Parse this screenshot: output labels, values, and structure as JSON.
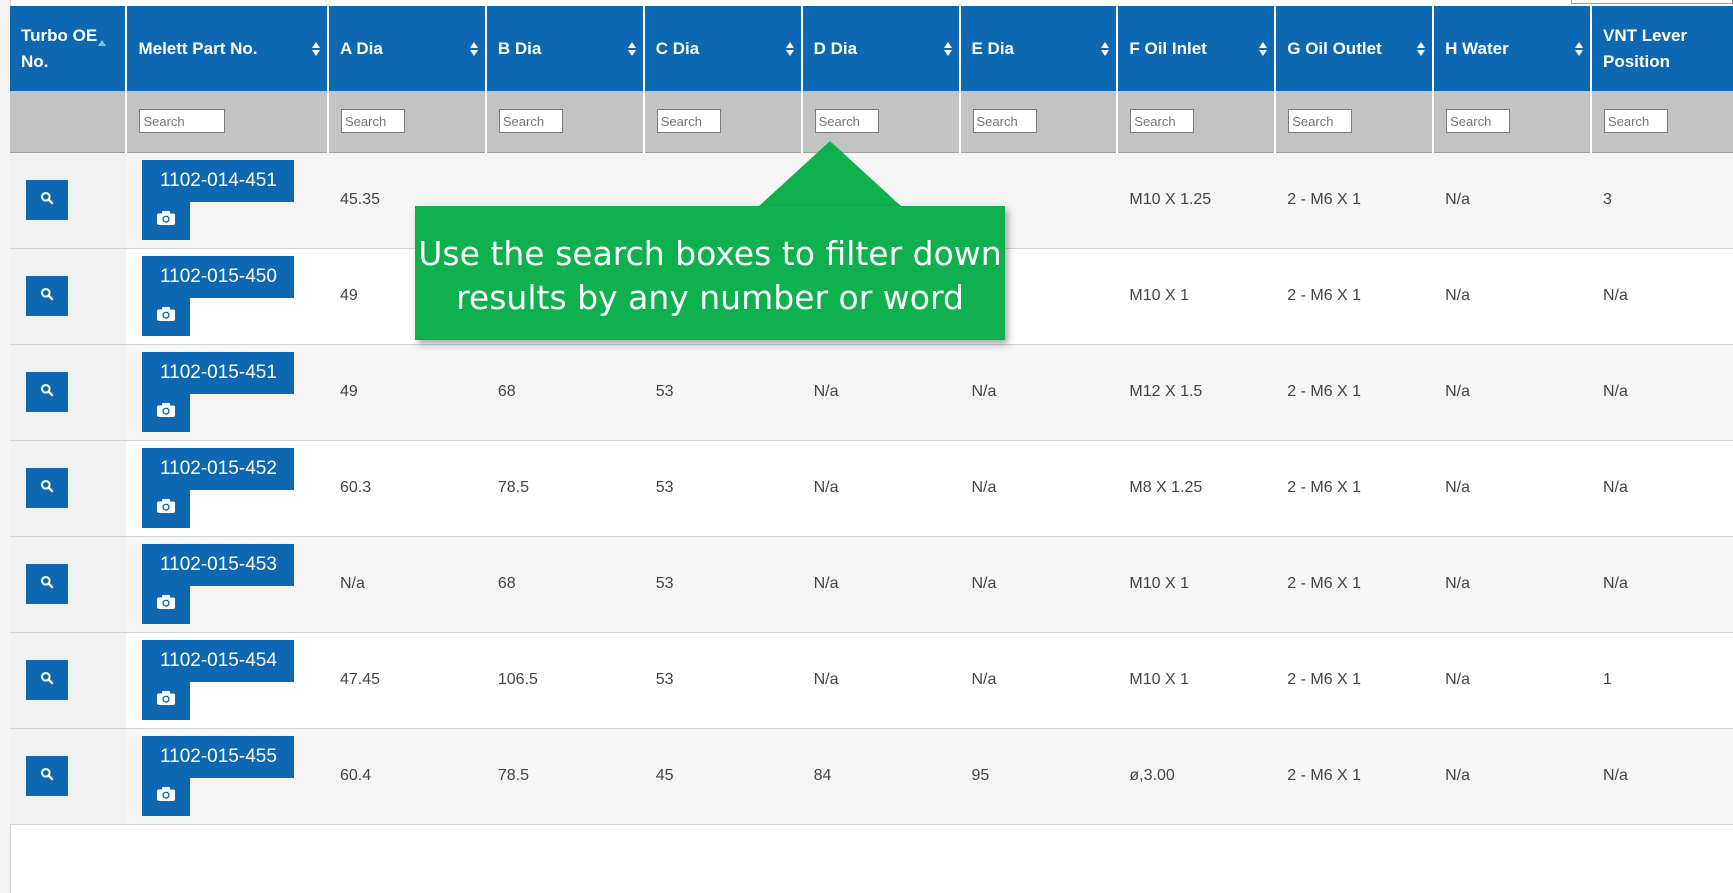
{
  "columns": [
    {
      "label": "Turbo OE No.",
      "placeholder": ""
    },
    {
      "label": "Melett Part No.",
      "placeholder": "Search"
    },
    {
      "label": "A Dia",
      "placeholder": "Search"
    },
    {
      "label": "B Dia",
      "placeholder": "Search"
    },
    {
      "label": "C Dia",
      "placeholder": "Search"
    },
    {
      "label": "D Dia",
      "placeholder": "Search"
    },
    {
      "label": "E Dia",
      "placeholder": "Search"
    },
    {
      "label": "F Oil Inlet",
      "placeholder": "Search"
    },
    {
      "label": "G Oil Outlet",
      "placeholder": "Search"
    },
    {
      "label": "H Water",
      "placeholder": "Search"
    },
    {
      "label": "VNT Lever Position",
      "placeholder": "Search"
    }
  ],
  "rows": [
    {
      "part_no": "1102-014-451",
      "cells": [
        "45.35",
        "",
        "",
        "",
        "",
        "M10 X 1.25",
        "2 - M6 X 1",
        "N/a",
        "3"
      ]
    },
    {
      "part_no": "1102-015-450",
      "cells": [
        "49",
        "",
        "",
        "",
        "",
        "M10 X 1",
        "2 - M6 X 1",
        "N/a",
        "N/a"
      ]
    },
    {
      "part_no": "1102-015-451",
      "cells": [
        "49",
        "68",
        "53",
        "N/a",
        "N/a",
        "M12 X 1.5",
        "2 - M6 X 1",
        "N/a",
        "N/a"
      ]
    },
    {
      "part_no": "1102-015-452",
      "cells": [
        "60.3",
        "78.5",
        "53",
        "N/a",
        "N/a",
        "M8 X 1.25",
        "2 - M6 X 1",
        "N/a",
        "N/a"
      ]
    },
    {
      "part_no": "1102-015-453",
      "cells": [
        "N/a",
        "68",
        "53",
        "N/a",
        "N/a",
        "M10 X 1",
        "2 - M6 X 1",
        "N/a",
        "N/a"
      ]
    },
    {
      "part_no": "1102-015-454",
      "cells": [
        "47.45",
        "106.5",
        "53",
        "N/a",
        "N/a",
        "M10 X 1",
        "2 - M6 X 1",
        "N/a",
        "1"
      ]
    },
    {
      "part_no": "1102-015-455",
      "cells": [
        "60.4",
        "78.5",
        "45",
        "84",
        "95",
        "ø,3.00",
        "2 - M6 X 1",
        "N/a",
        "N/a"
      ]
    }
  ],
  "callout": {
    "line1": "Use the search boxes to filter down",
    "line2": "results by any number or word"
  },
  "icons": {
    "row_action": "search-icon",
    "photo": "camera-icon",
    "sort": "sort-arrows-icon"
  },
  "colors": {
    "header_bg": "#0d68b1",
    "filter_row_bg": "#c3c3c3",
    "button_bg": "#0d68b1",
    "callout_bg": "#0eb14e"
  }
}
